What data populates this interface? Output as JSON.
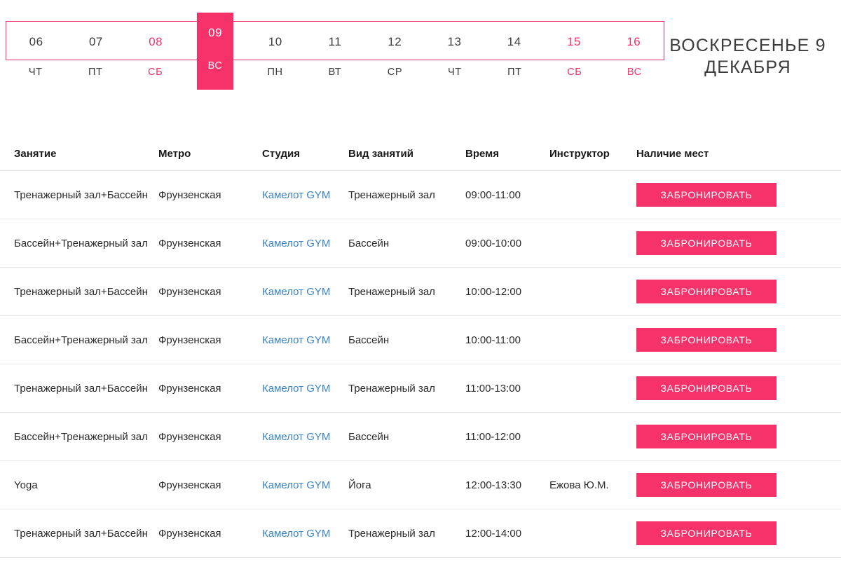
{
  "datepicker": {
    "days": [
      {
        "num": "06",
        "dow": "ЧТ",
        "weekend": false,
        "selected": false
      },
      {
        "num": "07",
        "dow": "ПТ",
        "weekend": false,
        "selected": false
      },
      {
        "num": "08",
        "dow": "СБ",
        "weekend": true,
        "selected": false
      },
      {
        "num": "09",
        "dow": "ВС",
        "weekend": true,
        "selected": true
      },
      {
        "num": "10",
        "dow": "ПН",
        "weekend": false,
        "selected": false
      },
      {
        "num": "11",
        "dow": "ВТ",
        "weekend": false,
        "selected": false
      },
      {
        "num": "12",
        "dow": "СР",
        "weekend": false,
        "selected": false
      },
      {
        "num": "13",
        "dow": "ЧТ",
        "weekend": false,
        "selected": false
      },
      {
        "num": "14",
        "dow": "ПТ",
        "weekend": false,
        "selected": false
      },
      {
        "num": "15",
        "dow": "СБ",
        "weekend": true,
        "selected": false
      },
      {
        "num": "16",
        "dow": "ВС",
        "weekend": true,
        "selected": false
      }
    ],
    "selected_date_title": "ВОСКРЕСЕНЬЕ 9 ДЕКАБРЯ",
    "accent_color": "#f5336a"
  },
  "schedule": {
    "columns": [
      "Занятие",
      "Метро",
      "Студия",
      "Вид занятий",
      "Время",
      "Инструктор",
      "Наличие мест"
    ],
    "book_label": "ЗАБРОНИРОВАТЬ",
    "link_color": "#3c83c6",
    "rows": [
      {
        "class": "Тренажерный зал+Бассейн",
        "metro": "Фрунзенская",
        "studio": "Камелот GYM",
        "type": "Тренажерный зал",
        "time": "09:00-11:00",
        "instructor": ""
      },
      {
        "class": "Бассейн+Тренажерный зал",
        "metro": "Фрунзенская",
        "studio": "Камелот GYM",
        "type": "Бассейн",
        "time": "09:00-10:00",
        "instructor": ""
      },
      {
        "class": "Тренажерный зал+Бассейн",
        "metro": "Фрунзенская",
        "studio": "Камелот GYM",
        "type": "Тренажерный зал",
        "time": "10:00-12:00",
        "instructor": ""
      },
      {
        "class": "Бассейн+Тренажерный зал",
        "metro": "Фрунзенская",
        "studio": "Камелот GYM",
        "type": "Бассейн",
        "time": "10:00-11:00",
        "instructor": ""
      },
      {
        "class": "Тренажерный зал+Бассейн",
        "metro": "Фрунзенская",
        "studio": "Камелот GYM",
        "type": "Тренажерный зал",
        "time": "11:00-13:00",
        "instructor": ""
      },
      {
        "class": "Бассейн+Тренажерный зал",
        "metro": "Фрунзенская",
        "studio": "Камелот GYM",
        "type": "Бассейн",
        "time": "11:00-12:00",
        "instructor": ""
      },
      {
        "class": "Yoga",
        "metro": "Фрунзенская",
        "studio": "Камелот GYM",
        "type": "Йога",
        "time": "12:00-13:30",
        "instructor": "Ежова Ю.М."
      },
      {
        "class": "Тренажерный зал+Бассейн",
        "metro": "Фрунзенская",
        "studio": "Камелот GYM",
        "type": "Тренажерный зал",
        "time": "12:00-14:00",
        "instructor": ""
      }
    ]
  }
}
